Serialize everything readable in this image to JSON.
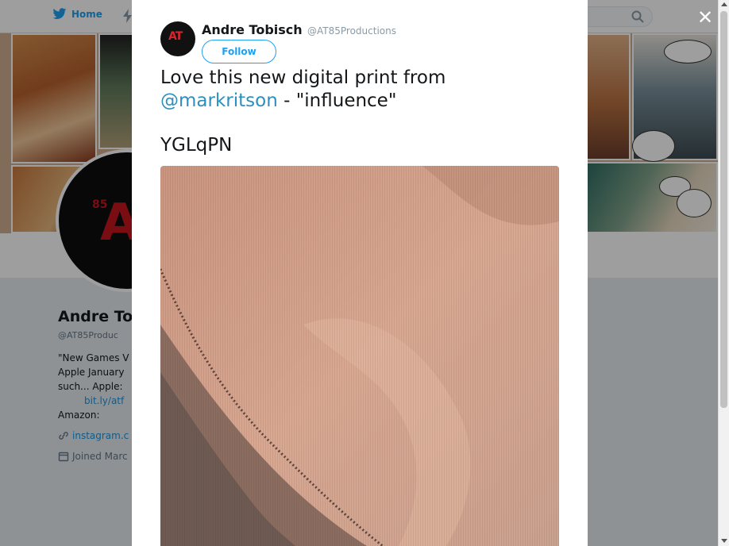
{
  "nav": {
    "home_label": "Home"
  },
  "profile": {
    "name": "Andre To",
    "handle": "@AT85Produc",
    "avatar_big_text": "A",
    "avatar_small_text": "85",
    "bio_lines": [
      "\"New Games V",
      "Apple January",
      "such... Apple:",
      "bit.ly/atf",
      "Amazon:"
    ],
    "website": "instagram.c",
    "joined": "Joined Marc"
  },
  "tweet": {
    "author_name": "Andre Tobisch",
    "author_handle": "@AT85Productions",
    "avatar_text": "AT",
    "follow_label": "Follow",
    "text_before": "Love this new digital print from",
    "mention": "@markritson",
    "text_after": " - \"influence\"",
    "code": "YGLqPN"
  },
  "controls": {
    "close_glyph": "✕"
  },
  "colors": {
    "accent": "#1da1f2",
    "mention": "#2d8fbd",
    "avatar_red": "#c4161c"
  }
}
